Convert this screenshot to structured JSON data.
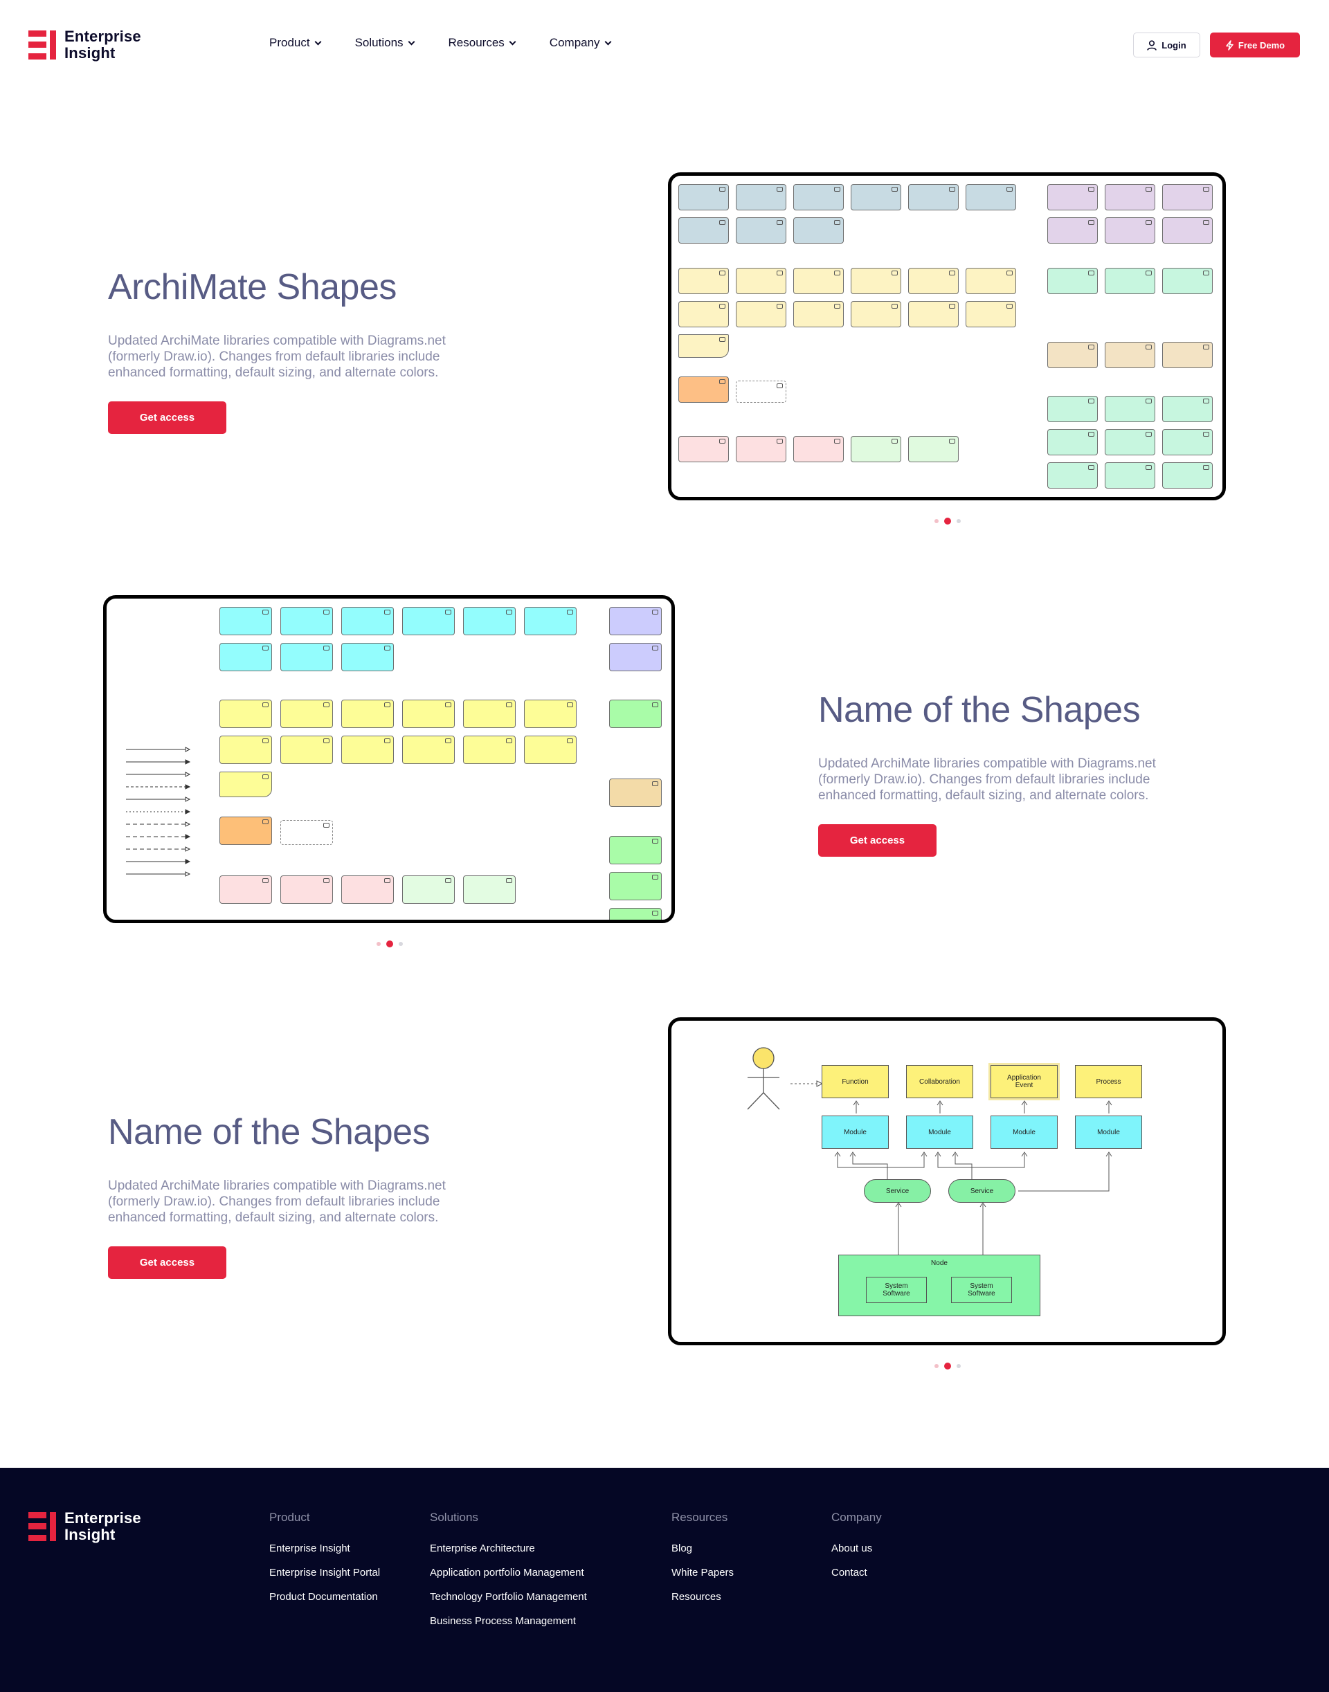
{
  "brand": {
    "name_line1": "Enterprise",
    "name_line2": "Insight"
  },
  "nav": {
    "items": [
      {
        "label": "Product"
      },
      {
        "label": "Solutions"
      },
      {
        "label": "Resources"
      },
      {
        "label": "Company"
      }
    ],
    "login_label": "Login",
    "demo_label": "Free Demo"
  },
  "sections": [
    {
      "title": "ArchiMate Shapes",
      "description": "Updated ArchiMate libraries compatible with Diagrams.net (formerly Draw.io). Changes from default libraries include enhanced formatting, default sizing, and alternate colors.",
      "button_label": "Get access"
    },
    {
      "title": "Name of the Shapes",
      "description": "Updated ArchiMate libraries compatible with Diagrams.net (formerly Draw.io). Changes from default libraries include enhanced formatting, default sizing, and alternate colors.",
      "button_label": "Get access"
    },
    {
      "title": "Name of the Shapes",
      "description": "Updated ArchiMate libraries compatible with Diagrams.net (formerly Draw.io). Changes from default libraries include enhanced formatting, default sizing, and alternate colors.",
      "button_label": "Get access"
    }
  ],
  "diagram": {
    "top_row": [
      "Function",
      "Collaboration",
      "Application Event",
      "Process"
    ],
    "module_label": "Module",
    "service_label": "Service",
    "node_label": "Node",
    "system_software_label": "System Software"
  },
  "colors": {
    "accent": "#e5243f",
    "heading": "#575b84",
    "footer_bg": "#050725"
  },
  "footer": {
    "columns": [
      {
        "title": "Product",
        "links": [
          "Enterprise Insight",
          "Enterprise Insight Portal",
          "Product Documentation"
        ]
      },
      {
        "title": "Solutions",
        "links": [
          "Enterprise Architecture",
          "Application portfolio Management",
          "Technology Portfolio Management",
          "Business Process Management"
        ]
      },
      {
        "title": "Resources",
        "links": [
          "Blog",
          "White Papers",
          "Resources"
        ]
      },
      {
        "title": "Company",
        "links": [
          "About us",
          "Contact"
        ]
      }
    ]
  }
}
